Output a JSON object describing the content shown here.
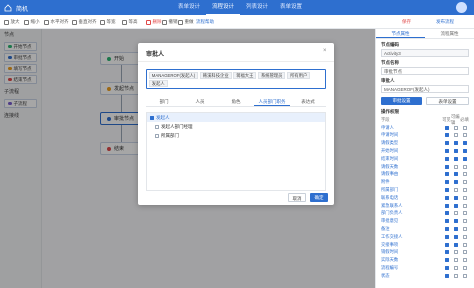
{
  "app": {
    "title": "简机",
    "avatar_color": "#cfe0ff"
  },
  "topbar": {
    "tabs": [
      {
        "label": "表单设计"
      },
      {
        "label": "流程设计"
      },
      {
        "label": "列表设计"
      },
      {
        "label": "表单设置"
      }
    ],
    "active_tab": "流程设计",
    "accent": "#2e6fcf"
  },
  "toolbar": {
    "buttons": [
      {
        "label": "放大",
        "icon": "zoom-in-icon"
      },
      {
        "label": "缩小",
        "icon": "zoom-out-icon"
      },
      {
        "label": "水平对齐",
        "icon": "align-horizontal-icon"
      },
      {
        "label": "垂直对齐",
        "icon": "align-vertical-icon"
      },
      {
        "label": "等宽",
        "icon": "same-width-icon"
      },
      {
        "label": "等高",
        "icon": "same-height-icon"
      }
    ],
    "delete_label": "删除",
    "undo_label": "撤销",
    "redo_label": "重做",
    "help_label": "流程帮助",
    "save_label": "保存",
    "publish_label": "发布流程"
  },
  "left_panel": {
    "section_nodes": "节点",
    "nodes": [
      {
        "label": "开始节点",
        "color": "#2bb673"
      },
      {
        "label": "审批节点",
        "color": "#2e6fcf"
      },
      {
        "label": "填写节点",
        "color": "#f0a020"
      },
      {
        "label": "结束节点",
        "color": "#e04a4a"
      }
    ],
    "section_sub": "子流程",
    "sub_items": [
      {
        "label": "子流程"
      }
    ],
    "section_lines": "连接线",
    "line_items": [
      {
        "label": "连接线"
      }
    ]
  },
  "canvas": {
    "nodes": [
      {
        "label": "开始",
        "color": "#2bb673"
      },
      {
        "label": "发起节点",
        "color": "#f0a020"
      },
      {
        "label": "审批节点",
        "color": "#2e6fcf"
      },
      {
        "label": "结束",
        "color": "#e04a4a"
      }
    ]
  },
  "right_panel": {
    "tabs": [
      {
        "label": "节点属性"
      },
      {
        "label": "流程属性"
      }
    ],
    "active_tab": "节点属性",
    "node_code_label": "节点编码",
    "node_code_value": "Activity3",
    "node_name_label": "节点名称",
    "node_name_value": "审批节点",
    "approvers_label": "审批人",
    "approvers_value": "MANAGEROF(发起人)",
    "btn_approval": "审批设置",
    "btn_form": "表单设置",
    "perm_label": "操作权限",
    "perm_headers": {
      "field": "字段",
      "visible": "可见",
      "editable": "可编辑",
      "required": "必填"
    },
    "permissions": [
      {
        "field": "申请人",
        "visible": true,
        "editable": false,
        "required": false
      },
      {
        "field": "申请时间",
        "visible": true,
        "editable": false,
        "required": false
      },
      {
        "field": "请假类型",
        "visible": true,
        "editable": true,
        "required": true
      },
      {
        "field": "开始时间",
        "visible": true,
        "editable": true,
        "required": true
      },
      {
        "field": "结束时间",
        "visible": true,
        "editable": true,
        "required": true
      },
      {
        "field": "请假天数",
        "visible": true,
        "editable": false,
        "required": false
      },
      {
        "field": "请假事由",
        "visible": true,
        "editable": true,
        "required": false
      },
      {
        "field": "附件",
        "visible": true,
        "editable": true,
        "required": false
      },
      {
        "field": "所属部门",
        "visible": true,
        "editable": false,
        "required": false
      },
      {
        "field": "联系电话",
        "visible": true,
        "editable": true,
        "required": false
      },
      {
        "field": "紧急联系人",
        "visible": true,
        "editable": true,
        "required": false
      },
      {
        "field": "部门负责人",
        "visible": true,
        "editable": false,
        "required": false
      },
      {
        "field": "审批意见",
        "visible": true,
        "editable": true,
        "required": false
      },
      {
        "field": "备注",
        "visible": true,
        "editable": true,
        "required": false
      },
      {
        "field": "工作交接人",
        "visible": true,
        "editable": true,
        "required": false
      },
      {
        "field": "交接事项",
        "visible": true,
        "editable": true,
        "required": false
      },
      {
        "field": "销假时间",
        "visible": true,
        "editable": false,
        "required": false
      },
      {
        "field": "实际天数",
        "visible": true,
        "editable": false,
        "required": false
      },
      {
        "field": "流程编号",
        "visible": true,
        "editable": false,
        "required": false
      },
      {
        "field": "状态",
        "visible": true,
        "editable": false,
        "required": false
      }
    ]
  },
  "modal": {
    "title": "审批人",
    "close_symbol": "×",
    "tags": [
      "MANAGEROF(发起人)",
      "韩溪科技企业",
      "蒋福大王",
      "系统管理员",
      "所有用户",
      "发起人"
    ],
    "tabs": [
      {
        "label": "部门"
      },
      {
        "label": "人员"
      },
      {
        "label": "角色"
      },
      {
        "label": "人员部门职务"
      },
      {
        "label": "表达式"
      }
    ],
    "active_tab": "人员部门职务",
    "items": [
      {
        "label": "发起人",
        "checked": true,
        "selected": true,
        "sub": false
      },
      {
        "label": "发起人部门经理",
        "checked": false,
        "selected": false,
        "sub": true
      },
      {
        "label": "所属部门",
        "checked": false,
        "selected": false,
        "sub": true
      }
    ],
    "cancel_label": "取消",
    "ok_label": "确定"
  }
}
